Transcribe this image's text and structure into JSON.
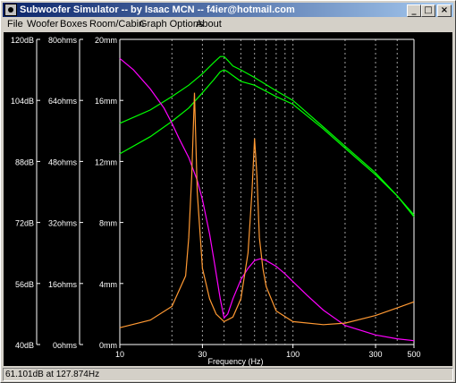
{
  "window": {
    "title": "Subwoofer Simulator -- by Isaac MCN -- f4ier@hotmail.com",
    "minimize_glyph": "_",
    "maximize_glyph": "□",
    "close_glyph": "×"
  },
  "menu": {
    "items": [
      "File",
      "Woofer",
      "Boxes",
      "Room/Cabin",
      "Graph Options",
      "About"
    ]
  },
  "status": {
    "text": "61.101dB at 127.874Hz"
  },
  "colors": {
    "background": "#000000",
    "axis": "#ffffff",
    "grid": "#a0a0a0",
    "spl_curves": "#00ff00",
    "impedance_curve": "#ff00ff",
    "excursion_curve": "#ff9933"
  },
  "chart_data": {
    "type": "line",
    "xlabel": "Frequency (Hz)",
    "x_scale": "log",
    "xlim": [
      10,
      500
    ],
    "x_tick_labels": [
      "10",
      "30",
      "100",
      "300",
      "500"
    ],
    "x_ticks": [
      10,
      30,
      100,
      300,
      500
    ],
    "x_grid": [
      20,
      30,
      40,
      50,
      60,
      70,
      80,
      90,
      100,
      200,
      300,
      400
    ],
    "y_axes": [
      {
        "name": "dB",
        "range": [
          40,
          120
        ],
        "tick_labels": [
          "120dB",
          "104dB",
          "88dB",
          "72dB",
          "56dB",
          "40dB"
        ]
      },
      {
        "name": "ohms",
        "range": [
          0,
          80
        ],
        "tick_labels": [
          "80ohms",
          "64ohms",
          "48ohms",
          "32ohms",
          "16ohms",
          "0ohms"
        ]
      },
      {
        "name": "mm",
        "range": [
          0,
          20
        ],
        "tick_labels": [
          "20mm",
          "16mm",
          "12mm",
          "8mm",
          "4mm",
          "0mm"
        ]
      }
    ],
    "series": [
      {
        "axis": "dB",
        "color": "#00ff00",
        "x": [
          10,
          15,
          20,
          25,
          30,
          35,
          38,
          40,
          42,
          45,
          50,
          60,
          80,
          100,
          150,
          200,
          300,
          400,
          500
        ],
        "values": [
          98,
          101.5,
          105,
          108,
          111,
          114,
          115.5,
          115.5,
          114.5,
          113,
          112,
          110,
          106.5,
          104,
          97,
          92,
          85,
          79,
          74
        ]
      },
      {
        "axis": "dB",
        "color": "#00ff00",
        "x": [
          10,
          15,
          20,
          25,
          30,
          35,
          38,
          40,
          42,
          45,
          50,
          60,
          80,
          100,
          150,
          200,
          300,
          400,
          500
        ],
        "values": [
          90,
          94.5,
          98.5,
          102,
          106,
          109.5,
          111.5,
          112,
          111.5,
          110.5,
          109,
          108,
          105,
          103,
          96.5,
          91.5,
          84.5,
          79,
          73.5
        ]
      },
      {
        "axis": "ohms",
        "color": "#ff00ff",
        "x": [
          10,
          12,
          15,
          18,
          20,
          22,
          25,
          28,
          30,
          33,
          35,
          38,
          40,
          42,
          45,
          50,
          55,
          60,
          65,
          70,
          80,
          90,
          100,
          120,
          150,
          200,
          300,
          400,
          500
        ],
        "values": [
          75,
          72,
          67,
          62,
          58,
          54,
          49,
          43,
          38,
          29,
          22,
          12,
          7,
          8,
          12,
          17,
          20,
          22,
          22.5,
          22,
          20.5,
          18.5,
          16.5,
          13,
          9,
          5,
          2.5,
          1.5,
          1
        ]
      },
      {
        "axis": "mm",
        "color": "#ff9933",
        "x": [
          10,
          15,
          20,
          24,
          25,
          26,
          27,
          28,
          30,
          33,
          36,
          40,
          45,
          50,
          55,
          58,
          60,
          62,
          64,
          67,
          70,
          80,
          100,
          150,
          200,
          300,
          400,
          500
        ],
        "values": [
          1.1,
          1.6,
          2.5,
          4.5,
          7,
          11,
          16.5,
          10,
          5,
          3,
          2,
          1.5,
          1.8,
          3,
          6,
          10,
          13.5,
          11,
          7,
          5,
          3.8,
          2.2,
          1.5,
          1.3,
          1.4,
          1.9,
          2.4,
          2.8
        ]
      }
    ]
  }
}
